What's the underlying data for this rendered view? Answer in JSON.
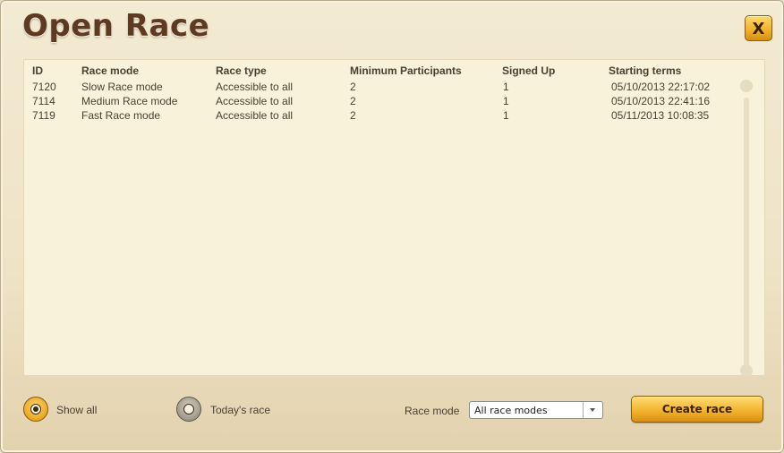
{
  "dialog": {
    "title": "Open Race",
    "close_label": "X"
  },
  "table": {
    "headers": [
      "ID",
      "Race mode",
      "Race type",
      "Minimum Participants",
      "Signed Up",
      "Starting terms"
    ],
    "rows": [
      [
        "7120",
        "Slow Race mode",
        "Accessible to all",
        "2",
        "1",
        "05/10/2013 22:17:02"
      ],
      [
        "7114",
        "Medium Race mode",
        "Accessible to all",
        "2",
        "1",
        "05/10/2013 22:41:16"
      ],
      [
        "7119",
        "Fast Race mode",
        "Accessible to all",
        "2",
        "1",
        "05/11/2013 10:08:35"
      ]
    ]
  },
  "filters": {
    "show_all_label": "Show all",
    "show_all_selected": true,
    "todays_race_label": "Today's race",
    "todays_race_selected": false,
    "race_mode_label": "Race mode",
    "race_mode_value": "All race modes"
  },
  "actions": {
    "create_race_label": "Create race"
  },
  "icons": {
    "close": "close-icon",
    "dropdown": "chevron-down-icon"
  }
}
